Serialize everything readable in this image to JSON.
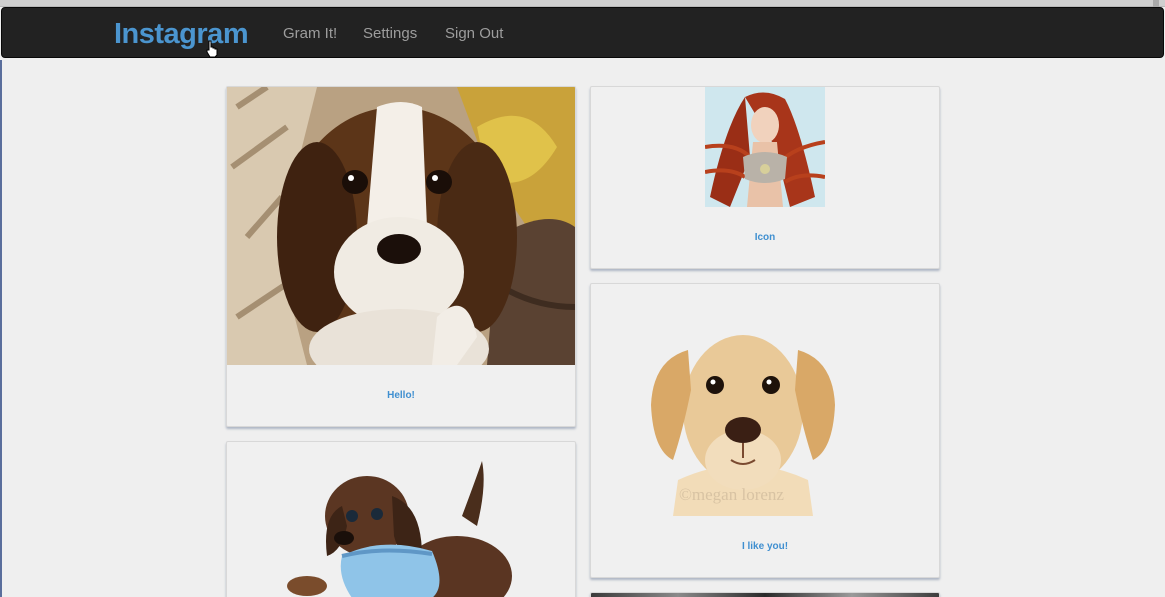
{
  "navbar": {
    "brand": "Instagram",
    "links": [
      "Gram It!",
      "Settings",
      "Sign Out"
    ]
  },
  "posts": [
    {
      "caption": "Hello!",
      "image_icon": "beagle-puppy-photo"
    },
    {
      "caption": "Icon",
      "image_icon": "red-haired-warrior-illustration"
    },
    {
      "caption": "I like you!",
      "image_icon": "labrador-puppy-photo",
      "watermark": "©megan lorenz"
    },
    {
      "caption": "",
      "image_icon": "dachshund-puppy-in-blue-shirt-photo"
    },
    {
      "caption": "",
      "image_icon": "partially-visible-photo"
    }
  ],
  "colors": {
    "navbar_bg": "#222222",
    "brand": "#4b95cf",
    "nav_link": "#9d9d9d",
    "caption": "#3f8fd0",
    "page_bg": "#efefef"
  }
}
